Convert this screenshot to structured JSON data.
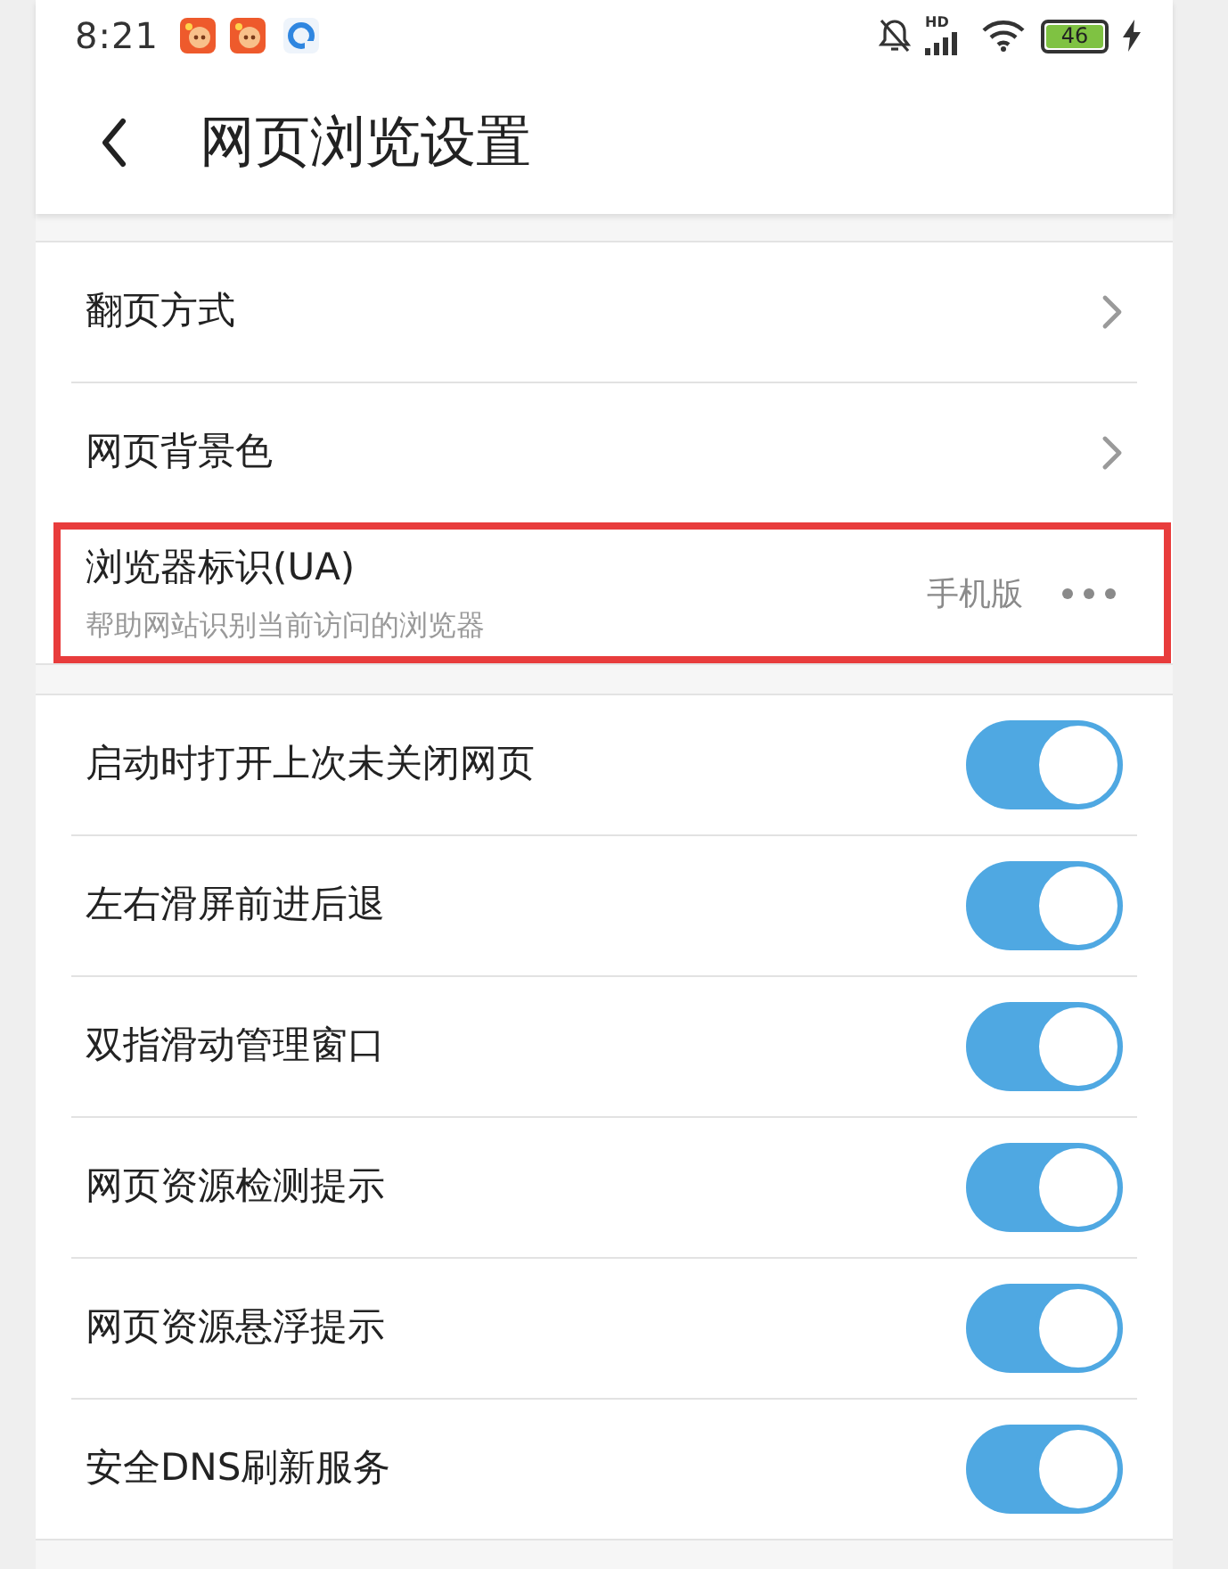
{
  "status_bar": {
    "time": "8:21",
    "network_label": "HD",
    "battery": "46"
  },
  "header": {
    "title": "网页浏览设置"
  },
  "sections": [
    {
      "items": [
        {
          "kind": "nav",
          "title": "翻页方式",
          "highlighted": false
        },
        {
          "kind": "nav",
          "title": "网页背景色",
          "highlighted": false
        },
        {
          "kind": "option",
          "title": "浏览器标识(UA)",
          "subtitle": "帮助网站识别当前访问的浏览器",
          "value": "手机版",
          "highlighted": true
        }
      ]
    },
    {
      "items": [
        {
          "kind": "toggle",
          "title": "启动时打开上次未关闭网页",
          "on": true
        },
        {
          "kind": "toggle",
          "title": "左右滑屏前进后退",
          "on": true
        },
        {
          "kind": "toggle",
          "title": "双指滑动管理窗口",
          "on": true
        },
        {
          "kind": "toggle",
          "title": "网页资源检测提示",
          "on": true
        },
        {
          "kind": "toggle",
          "title": "网页资源悬浮提示",
          "on": true
        },
        {
          "kind": "toggle",
          "title": "安全DNS刷新服务",
          "on": true
        }
      ]
    }
  ]
}
